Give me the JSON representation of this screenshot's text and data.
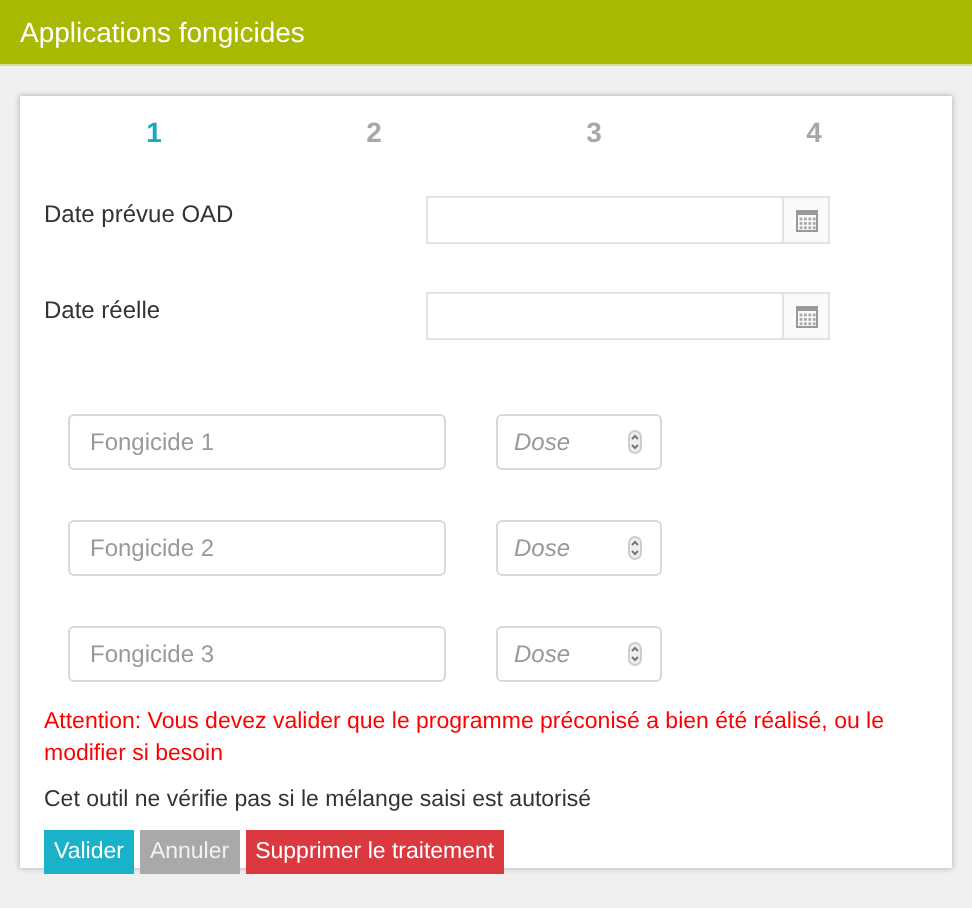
{
  "header": {
    "title": "Applications fongicides"
  },
  "steps": [
    {
      "label": "1",
      "selected": true
    },
    {
      "label": "2",
      "selected": false
    },
    {
      "label": "3",
      "selected": false
    },
    {
      "label": "4",
      "selected": false
    }
  ],
  "date_fields": [
    {
      "label": "Date prévue OAD"
    },
    {
      "label": "Date réelle"
    }
  ],
  "products": [
    {
      "name_placeholder": "Fongicide 1",
      "dose_placeholder": "Dose"
    },
    {
      "name_placeholder": "Fongicide 2",
      "dose_placeholder": "Dose"
    },
    {
      "name_placeholder": "Fongicide 3",
      "dose_placeholder": "Dose"
    }
  ],
  "warning": "Attention: Vous devez valider que le programme préconisé a bien été réalisé, ou le modifier si besoin",
  "note": "Cet outil ne vérifie pas si le mélange saisi est autorisé",
  "buttons": [
    {
      "label": "Valider",
      "kind": "primary",
      "disabled": false
    },
    {
      "label": "Annuler",
      "kind": "secondary",
      "disabled": true
    },
    {
      "label": "Supprimer le traitement",
      "kind": "danger",
      "disabled": false
    }
  ]
}
